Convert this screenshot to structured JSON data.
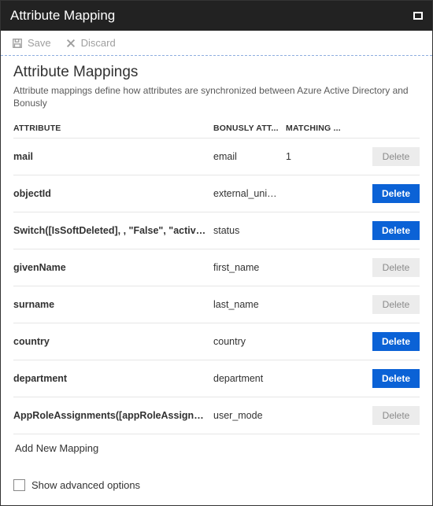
{
  "header": {
    "title": "Attribute Mapping"
  },
  "toolbar": {
    "save": "Save",
    "discard": "Discard"
  },
  "section": {
    "title": "Attribute Mappings",
    "description": "Attribute mappings define how attributes are synchronized between Azure Active Directory and Bonusly"
  },
  "columns": {
    "attribute": "ATTRIBUTE",
    "bonusly": "BONUSLY ATT...",
    "matching": "MATCHING ..."
  },
  "rows": [
    {
      "attribute": "mail",
      "bonusly": "email",
      "matching": "1",
      "btn": "Delete",
      "primary": false
    },
    {
      "attribute": "objectId",
      "bonusly": "external_uniq...",
      "matching": "",
      "btn": "Delete",
      "primary": true
    },
    {
      "attribute": "Switch([IsSoftDeleted], , \"False\", \"active\", \"True",
      "bonusly": "status",
      "matching": "",
      "btn": "Delete",
      "primary": true
    },
    {
      "attribute": "givenName",
      "bonusly": "first_name",
      "matching": "",
      "btn": "Delete",
      "primary": false
    },
    {
      "attribute": "surname",
      "bonusly": "last_name",
      "matching": "",
      "btn": "Delete",
      "primary": false
    },
    {
      "attribute": "country",
      "bonusly": "country",
      "matching": "",
      "btn": "Delete",
      "primary": true
    },
    {
      "attribute": "department",
      "bonusly": "department",
      "matching": "",
      "btn": "Delete",
      "primary": true
    },
    {
      "attribute": "AppRoleAssignments([appRoleAssignments])",
      "bonusly": "user_mode",
      "matching": "",
      "btn": "Delete",
      "primary": false
    }
  ],
  "addNew": "Add New Mapping",
  "advanced": "Show advanced options"
}
